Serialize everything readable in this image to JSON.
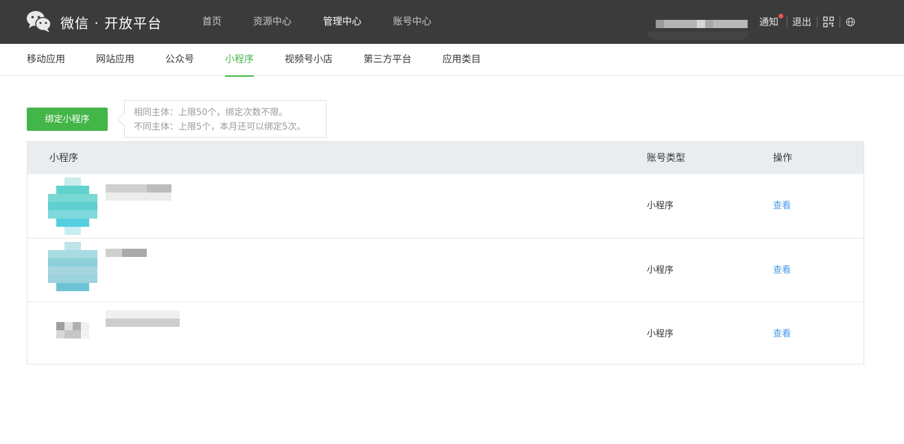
{
  "header": {
    "brand": "微信 · 开放平台",
    "nav": [
      {
        "label": "首页",
        "active": false
      },
      {
        "label": "资源中心",
        "active": false
      },
      {
        "label": "管理中心",
        "active": true
      },
      {
        "label": "账号中心",
        "active": false
      }
    ],
    "notify_label": "通知",
    "logout_label": "退出",
    "qr_icon": "qrcode-icon",
    "lang_icon": "globe-icon"
  },
  "subnav": {
    "tabs": [
      {
        "label": "移动应用",
        "active": false
      },
      {
        "label": "网站应用",
        "active": false
      },
      {
        "label": "公众号",
        "active": false
      },
      {
        "label": "小程序",
        "active": true
      },
      {
        "label": "视频号小店",
        "active": false
      },
      {
        "label": "第三方平台",
        "active": false
      },
      {
        "label": "应用类目",
        "active": false
      }
    ]
  },
  "actions": {
    "bind_button": "绑定小程序",
    "tip_line1": "相同主体：上限50个，绑定次数不限。",
    "tip_line2": "不同主体：上限5个，本月还可以绑定5次。"
  },
  "table": {
    "headers": {
      "name": "小程序",
      "type": "账号类型",
      "op": "操作"
    },
    "rows": [
      {
        "type": "小程序",
        "op": "查看"
      },
      {
        "type": "小程序",
        "op": "查看"
      },
      {
        "type": "小程序",
        "op": "查看"
      }
    ]
  },
  "colors": {
    "accent": "#44b549",
    "link": "#459ae9",
    "topbar": "#3b3b3b"
  }
}
